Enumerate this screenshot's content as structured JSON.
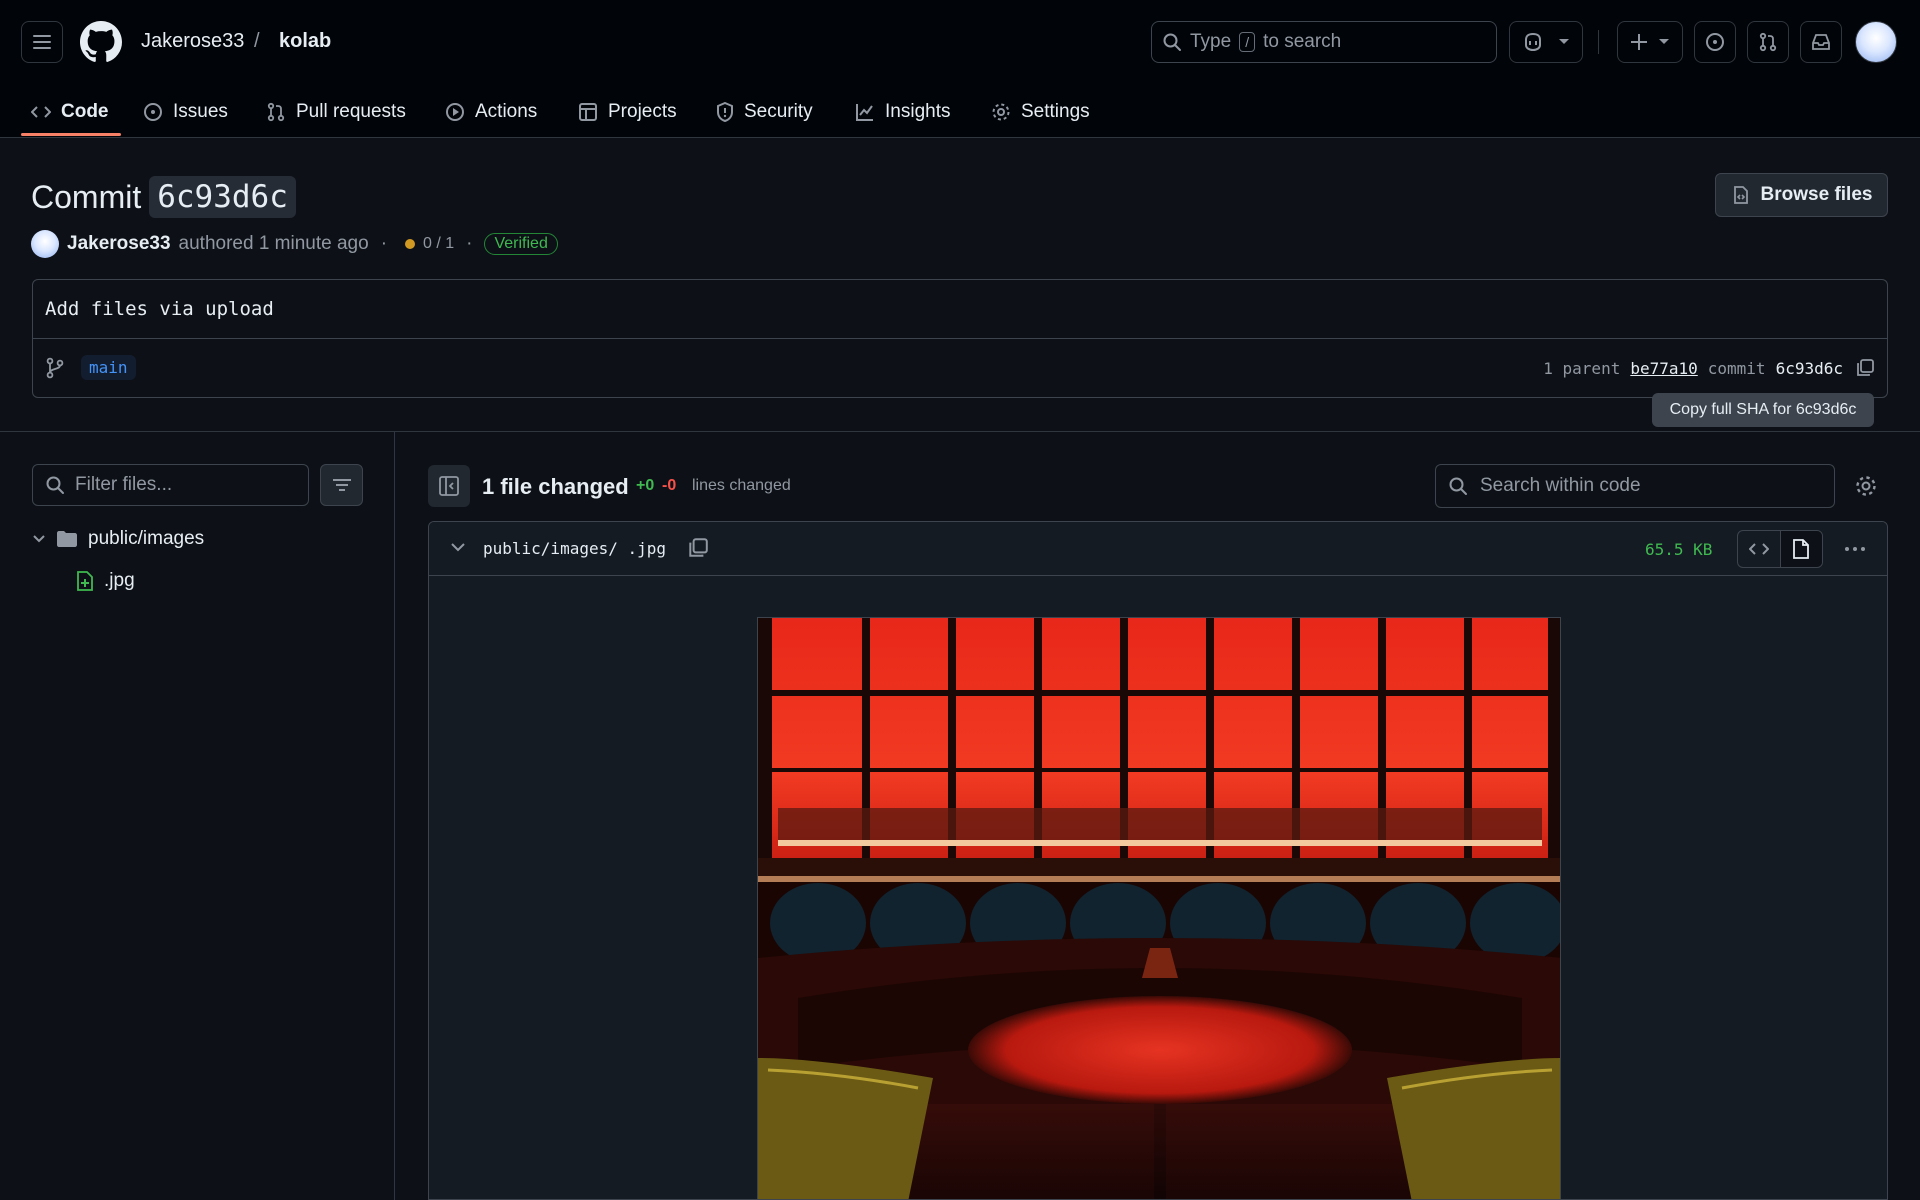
{
  "header": {
    "owner": "Jakerose33",
    "separator": "/",
    "repo": "kolab",
    "search": {
      "prefix": "Type",
      "key": "/",
      "suffix": "to search"
    }
  },
  "tabs": [
    {
      "label": "Code",
      "icon": "code-icon",
      "active": true
    },
    {
      "label": "Issues",
      "icon": "issue-opened-icon"
    },
    {
      "label": "Pull requests",
      "icon": "git-pull-request-icon"
    },
    {
      "label": "Actions",
      "icon": "play-icon"
    },
    {
      "label": "Projects",
      "icon": "table-icon"
    },
    {
      "label": "Security",
      "icon": "shield-icon"
    },
    {
      "label": "Insights",
      "icon": "graph-icon"
    },
    {
      "label": "Settings",
      "icon": "gear-icon"
    }
  ],
  "commit": {
    "title_prefix": "Commit",
    "sha_short": "6c93d6c",
    "browse_label": "Browse files",
    "author": "Jakerose33",
    "authored_text": "authored 1 minute ago",
    "dot": "·",
    "checks": "0 / 1",
    "verified": "Verified",
    "message": "Add files via upload",
    "branch": "main",
    "parent_label": "1 parent",
    "parent_sha": "be77a10",
    "commit_label": "commit",
    "commit_sha": "6c93d6c",
    "copy_tooltip": "Copy full SHA for 6c93d6c"
  },
  "file_tree": {
    "filter_placeholder": "Filter files...",
    "directory": "public/images",
    "file": ".jpg"
  },
  "diff": {
    "summary": "1 file changed",
    "additions": "+0",
    "deletions": "-0",
    "lines_changed": "lines changed",
    "search_placeholder": "Search within code",
    "file_path": "public/images/ .jpg",
    "file_size": "65.5 KB"
  },
  "colors": {
    "accent_underline": "#f78166",
    "verified_green": "#3fb950",
    "deletion_red": "#f85149",
    "branch_blue": "#4493f8",
    "status_orange": "#d29922"
  }
}
